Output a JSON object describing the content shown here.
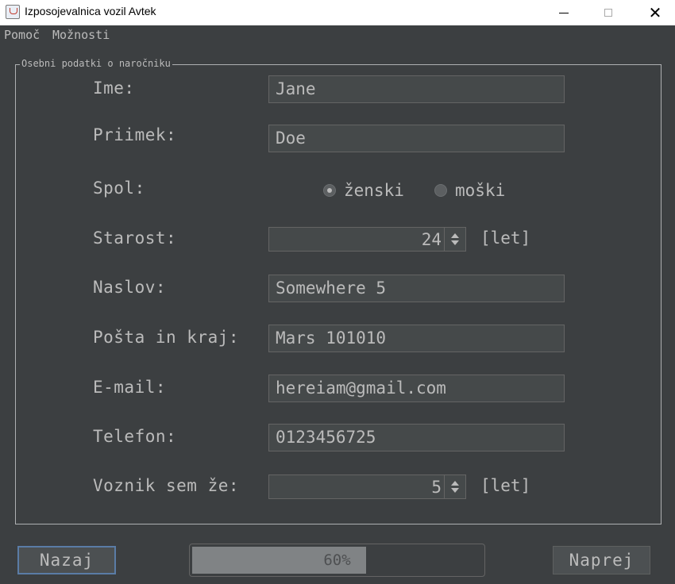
{
  "window": {
    "title": "Izposojevalnica vozil Avtek",
    "close_glyph": "✕"
  },
  "menu": [
    "Pomoč",
    "Možnosti"
  ],
  "panel": {
    "legend": "Osebni podatki o naročniku"
  },
  "form": {
    "ime": {
      "label": "Ime:",
      "value": "Jane"
    },
    "priimek": {
      "label": "Priimek:",
      "value": "Doe"
    },
    "spol": {
      "label": "Spol:",
      "options": [
        "ženski",
        "moški"
      ],
      "selected": "ženski"
    },
    "starost": {
      "label": "Starost:",
      "value": "24",
      "unit": "[let]"
    },
    "naslov": {
      "label": "Naslov:",
      "value": "Somewhere 5"
    },
    "posta": {
      "label": "Pošta in kraj:",
      "value": "Mars 101010"
    },
    "email": {
      "label": "E-mail:",
      "value": "hereiam@gmail.com"
    },
    "telefon": {
      "label": "Telefon:",
      "value": "0123456725"
    },
    "voznik": {
      "label": "Voznik sem že:",
      "value": "5",
      "unit": "[let]"
    }
  },
  "footer": {
    "back_label": "Nazaj",
    "next_label": "Naprej",
    "progress": {
      "value": 60,
      "label": "60%"
    }
  }
}
